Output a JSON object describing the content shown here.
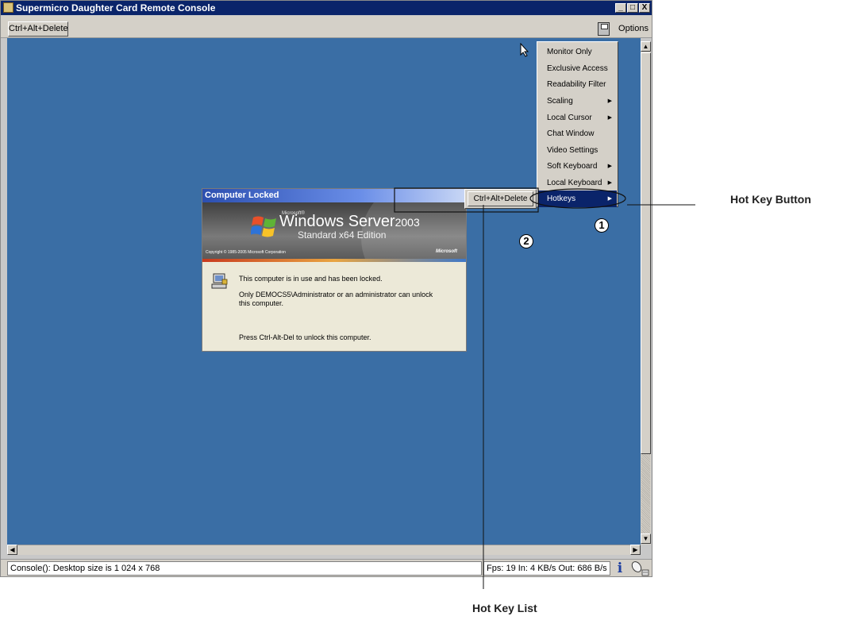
{
  "window": {
    "title": "Supermicro Daughter Card Remote Console",
    "controls": {
      "minimize": "_",
      "maximize": "□",
      "close": "X"
    }
  },
  "toolbar": {
    "ctrl_alt_delete_label": "Ctrl+Alt+Delete",
    "options_label": "Options",
    "save_icon": "floppy-disk-icon"
  },
  "options_menu": {
    "items": [
      {
        "label": "Monitor Only",
        "submenu": false
      },
      {
        "label": "Exclusive Access",
        "submenu": false
      },
      {
        "label": "Readability Filter",
        "submenu": false
      },
      {
        "label": "Scaling",
        "submenu": true
      },
      {
        "label": "Local Cursor",
        "submenu": true
      },
      {
        "label": "Chat Window",
        "submenu": false
      },
      {
        "label": "Video Settings",
        "submenu": false
      },
      {
        "label": "Soft Keyboard",
        "submenu": true
      },
      {
        "label": "Local Keyboard",
        "submenu": true
      },
      {
        "label": "Hotkeys",
        "submenu": true,
        "selected": true
      }
    ],
    "submenu_arrow": "▶",
    "hotkeys_submenu": {
      "items": [
        "Ctrl+Alt+Delete"
      ]
    }
  },
  "lock_dialog": {
    "title": "Computer Locked",
    "microsoft_small": "Microsoft®",
    "product_name": "Windows Server",
    "product_year": "2003",
    "edition": "Standard x64 Edition",
    "copyright": "Copyright © 1985-2005  Microsoft Corporation",
    "brand": "Microsoft",
    "line1": "This computer is in use and has been locked.",
    "line2": "Only DEMOCS5\\Administrator or an administrator can unlock this computer.",
    "line3": "Press Ctrl-Alt-Del to unlock this computer."
  },
  "statusbar": {
    "left_text": "Console(): Desktop size is 1 024 x 768",
    "right_text": "Fps: 19 In: 4 KB/s Out: 686 B/s",
    "info_icon": "i"
  },
  "annotations": {
    "hot_key_button": "Hot Key Button",
    "hot_key_list": "Hot Key List",
    "marker_1": "1",
    "marker_2": "2"
  },
  "colors": {
    "desktop": "#3a6ea5",
    "titlebar": "#0a246a",
    "menu_selected": "#0a246a",
    "chrome": "#d4d0c8"
  }
}
